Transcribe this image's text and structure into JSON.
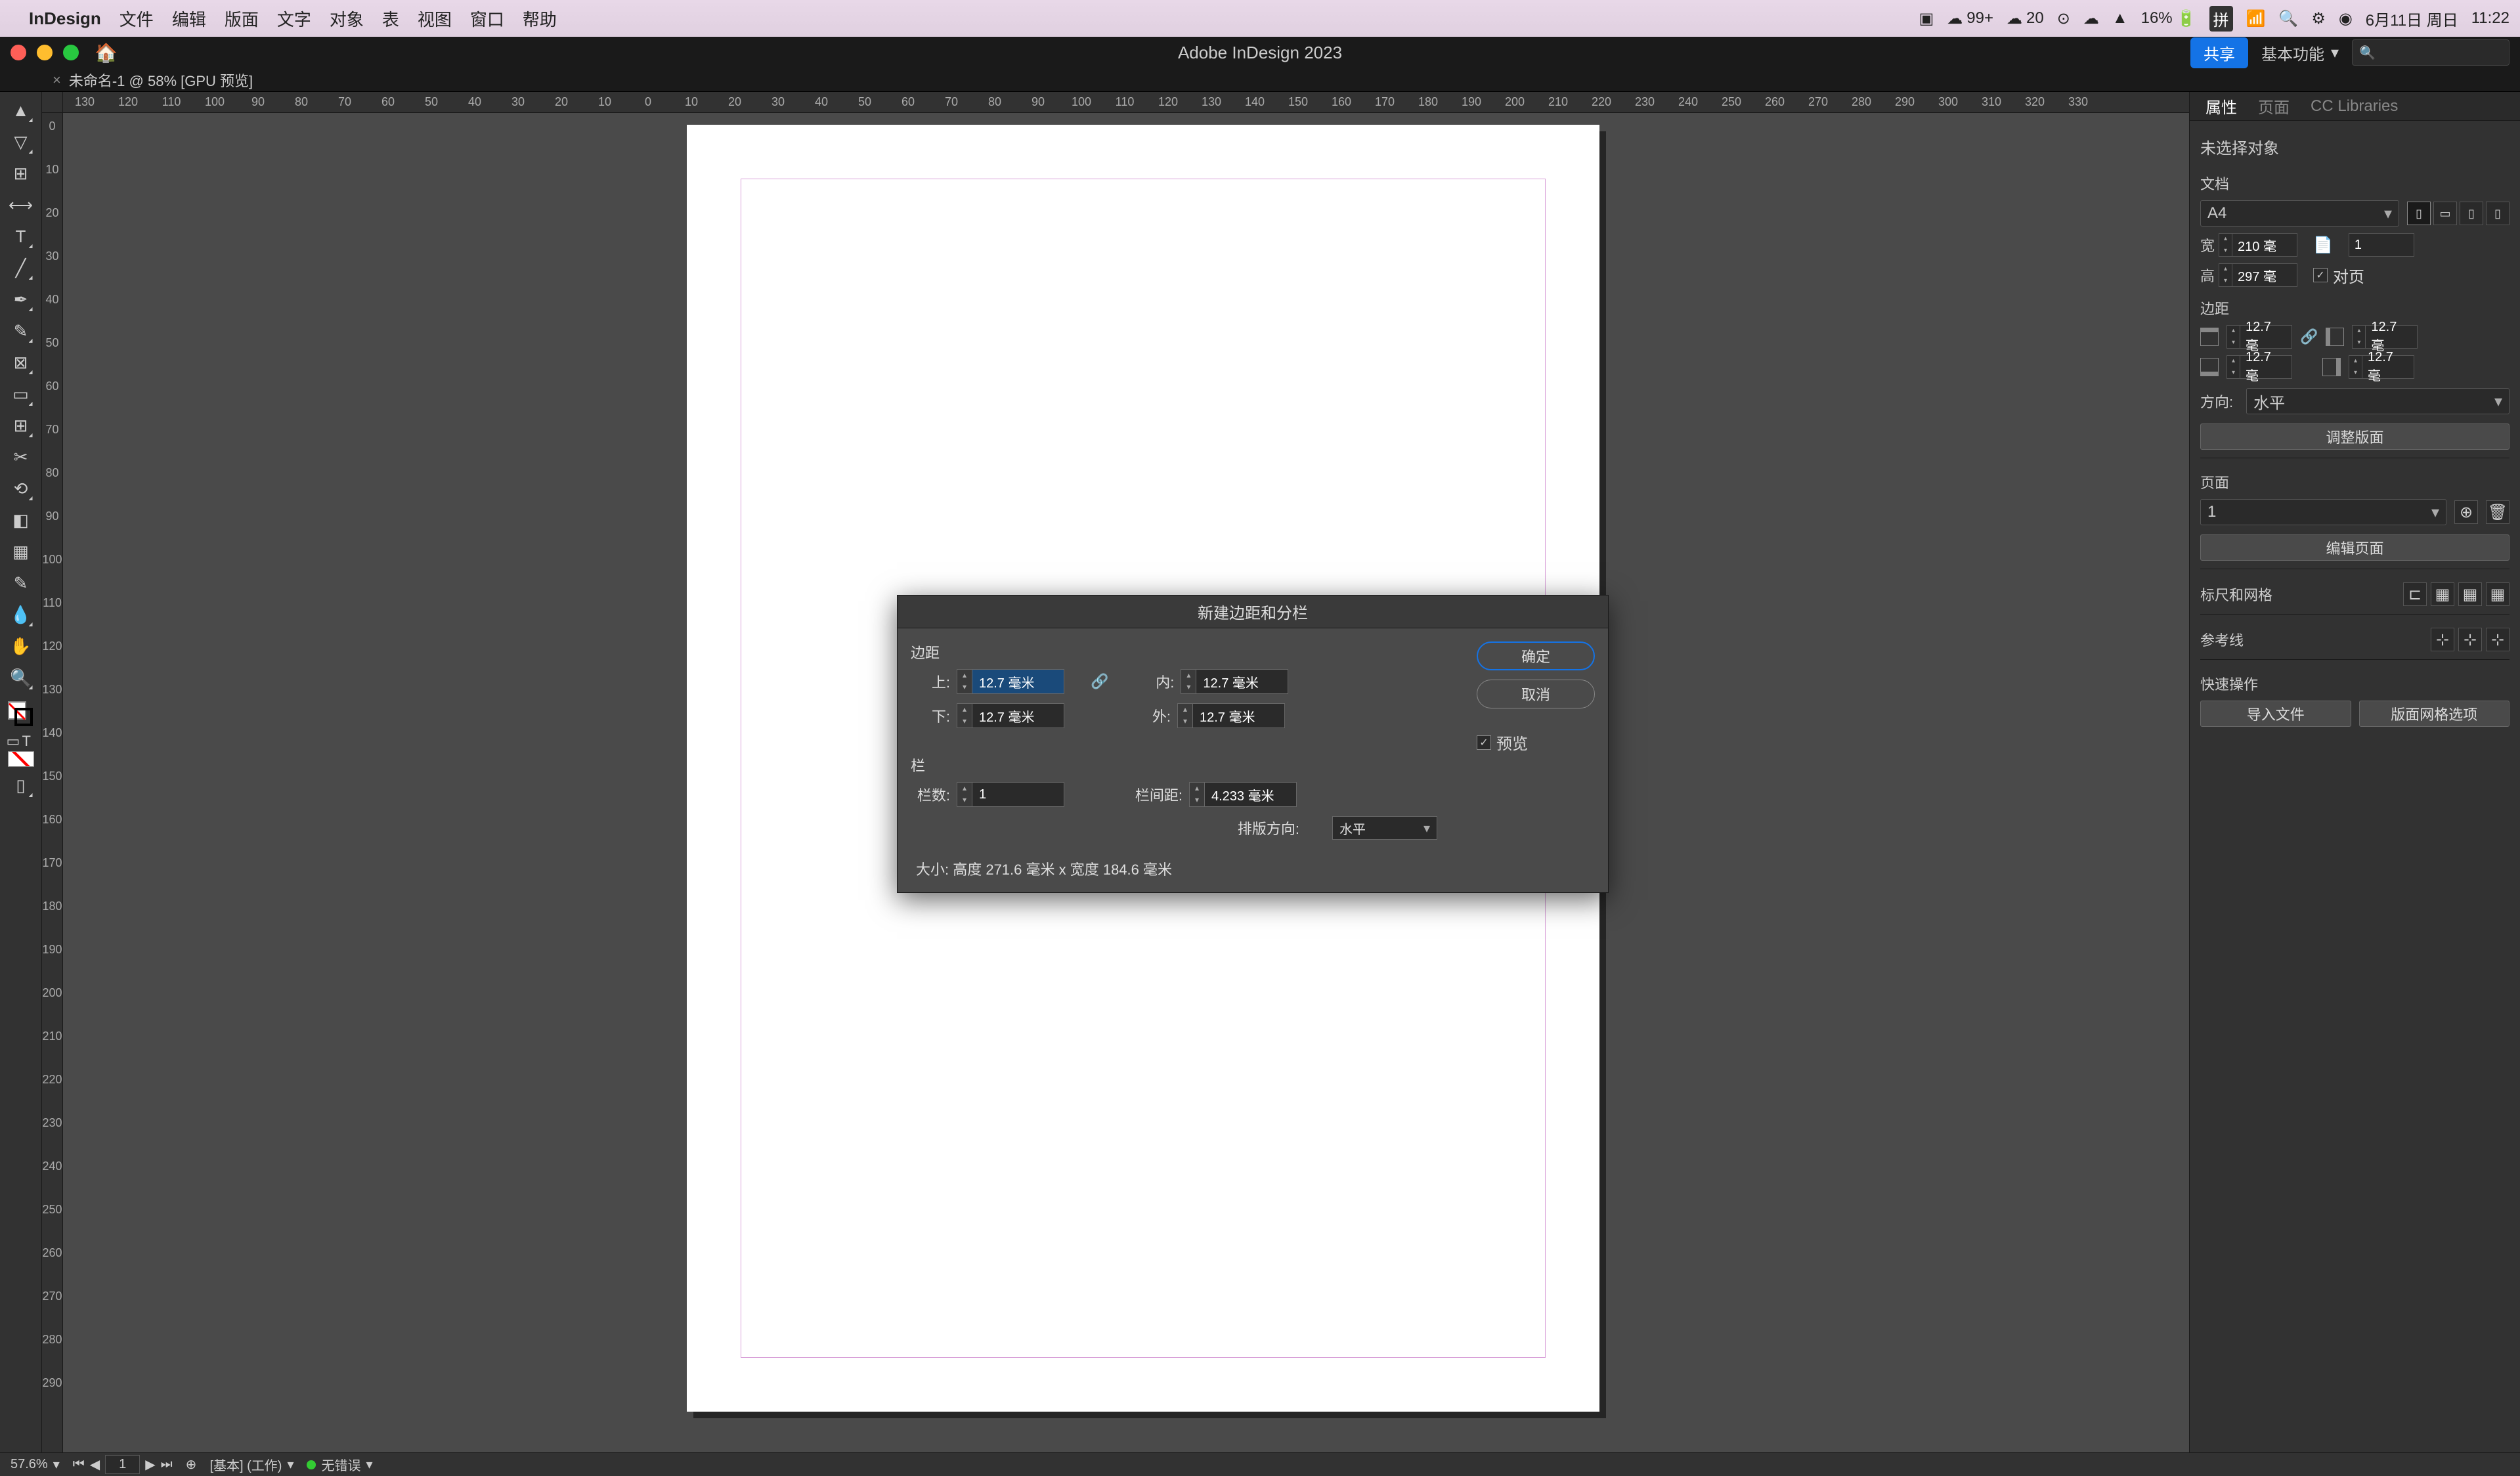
{
  "menubar": {
    "app": "InDesign",
    "items": [
      "文件",
      "编辑",
      "版面",
      "文字",
      "对象",
      "表",
      "视图",
      "窗口",
      "帮助"
    ],
    "right": {
      "badge1": "99+",
      "badge2": "20",
      "battery": "16%",
      "input_method": "拼",
      "date": "6月11日 周日",
      "time": "11:22"
    }
  },
  "titlebar": {
    "title": "Adobe InDesign 2023",
    "share": "共享",
    "workspace": "基本功能"
  },
  "doctab": "未命名-1 @ 58% [GPU 预览]",
  "ruler_h": [
    130,
    120,
    110,
    100,
    90,
    80,
    70,
    60,
    50,
    40,
    30,
    20,
    10,
    0,
    10,
    20,
    30,
    40,
    50,
    60,
    70,
    80,
    90,
    100,
    110,
    120,
    130,
    140,
    150,
    160,
    170,
    180,
    190,
    200,
    210,
    220,
    230,
    240,
    250,
    260,
    270,
    280,
    290,
    300,
    310,
    320,
    330
  ],
  "ruler_v": [
    0,
    10,
    20,
    30,
    40,
    50,
    60,
    70,
    80,
    90,
    100,
    110,
    120,
    130,
    140,
    150,
    160,
    170,
    180,
    190,
    200,
    210,
    220,
    230,
    240,
    250,
    260,
    270,
    280,
    290
  ],
  "panel": {
    "tabs": [
      "属性",
      "页面",
      "CC Libraries"
    ],
    "no_selection": "未选择对象",
    "doc_section": "文档",
    "page_size": "A4",
    "width_label": "宽",
    "width_value": "210 毫",
    "height_label": "高",
    "height_value": "297 毫",
    "pages_value": "1",
    "facing_label": "对页",
    "margins_section": "边距",
    "margin_top": "12.7 毫",
    "margin_bottom": "12.7 毫",
    "margin_left": "12.7 毫",
    "margin_right": "12.7 毫",
    "orientation_label": "方向:",
    "orientation_value": "水平",
    "adjust_layout": "调整版面",
    "pages_section": "页面",
    "pages_dropdown": "1",
    "edit_pages": "编辑页面",
    "ruler_grid": "标尺和网格",
    "guides": "参考线",
    "quick_actions": "快速操作",
    "import_file": "导入文件",
    "grid_options": "版面网格选项"
  },
  "dialog": {
    "title": "新建边距和分栏",
    "margins_label": "边距",
    "top_label": "上:",
    "top_value": "12.7 毫米",
    "bottom_label": "下:",
    "bottom_value": "12.7 毫米",
    "inner_label": "内:",
    "inner_value": "12.7 毫米",
    "outer_label": "外:",
    "outer_value": "12.7 毫米",
    "columns_label": "栏",
    "count_label": "栏数:",
    "count_value": "1",
    "gutter_label": "栏间距:",
    "gutter_value": "4.233 毫米",
    "direction_label": "排版方向:",
    "direction_value": "水平",
    "size_info": "大小: 高度 271.6 毫米 x 宽度 184.6 毫米",
    "ok": "确定",
    "cancel": "取消",
    "preview": "预览"
  },
  "statusbar": {
    "zoom": "57.6%",
    "page": "1",
    "preset": "[基本] (工作)",
    "errors": "无错误"
  }
}
